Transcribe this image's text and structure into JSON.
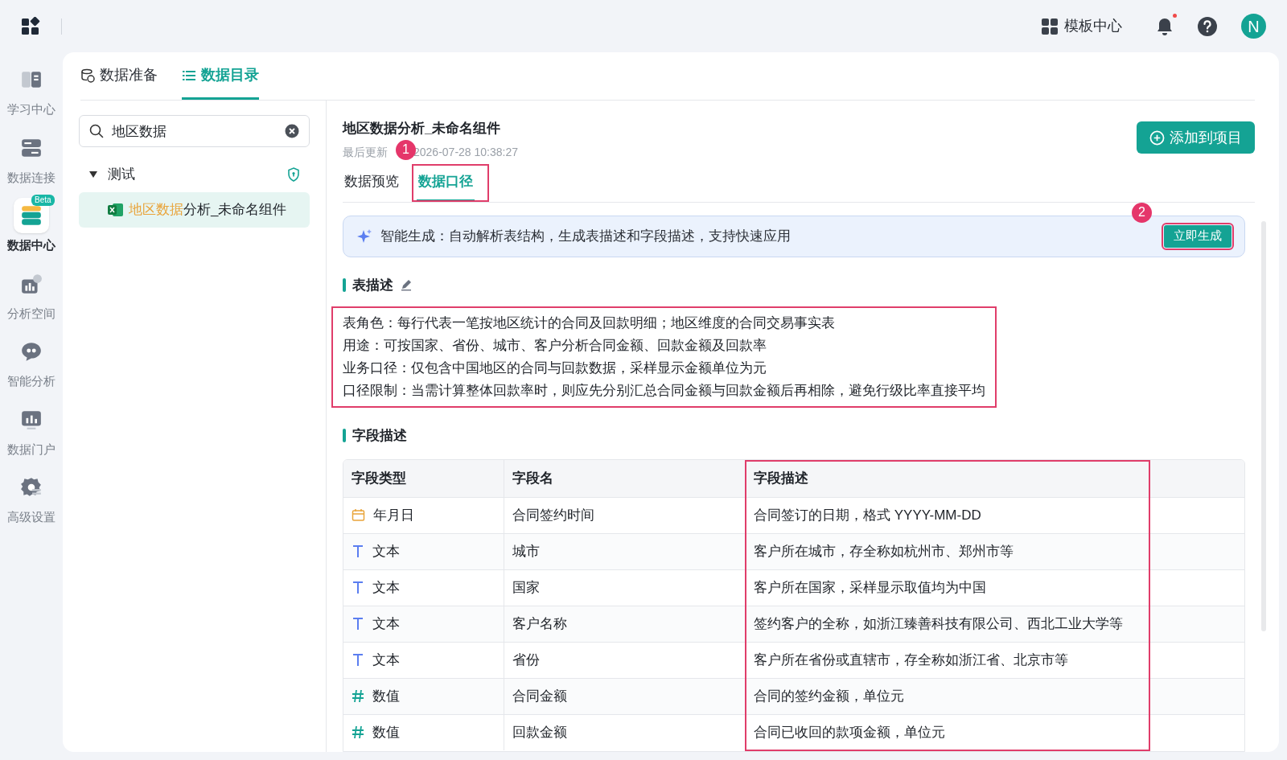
{
  "top_bar": {
    "template_center": "模板中心",
    "notification_dot": true,
    "avatar": "N"
  },
  "sidebar": {
    "items": [
      {
        "label": "学习中心",
        "selected": false
      },
      {
        "label": "数据连接",
        "selected": false
      },
      {
        "label": "数据中心",
        "selected": true,
        "badge": "Beta"
      },
      {
        "label": "分析空间",
        "selected": false
      },
      {
        "label": "智能分析",
        "selected": false
      },
      {
        "label": "数据门户",
        "selected": false
      },
      {
        "label": "高级设置",
        "selected": false
      }
    ]
  },
  "nav_tabs": [
    {
      "label": "数据准备",
      "selected": false
    },
    {
      "label": "数据目录",
      "selected": true
    }
  ],
  "search": {
    "value": "地区数据"
  },
  "tree": [
    {
      "label": "测试",
      "expanded": true,
      "children": [
        {
          "highlight": "地区数据",
          "label": "分析_未命名组件",
          "selected": true
        }
      ]
    }
  ],
  "detail": {
    "title": "地区数据分析_未命名组件",
    "updated": "最后更新",
    "updated_time": "2026-07-28 10:38:27",
    "add_button": "添加到项目",
    "tabs": [
      {
        "label": "数据预览",
        "selected": false
      },
      {
        "label": "数据口径",
        "selected": true,
        "marker": "1",
        "outlined": true
      }
    ],
    "banner": {
      "text": "智能生成：自动解析表结构，生成表描述和字段描述，支持快速应用",
      "button": "立即生成",
      "marker": "2",
      "outlined": true
    },
    "table_description": {
      "heading": "表描述",
      "outlined": true,
      "lines": [
        "表角色：每行代表一笔按地区统计的合同及回款明细；地区维度的合同交易事实表",
        "用途：可按国家、省份、城市、客户分析合同金额、回款金额及回款率",
        "业务口径：仅包含中国地区的合同与回款数据，采样显示金额单位为元",
        "口径限制：当需计算整体回款率时，则应先分别汇总合同金额与回款金额后再相除，避免行级比率直接平均"
      ]
    },
    "field_description": {
      "heading": "字段描述",
      "columns": [
        {
          "label": "字段类型",
          "outlined": false
        },
        {
          "label": "字段名",
          "outlined": false
        },
        {
          "label": "字段描述",
          "outlined": true
        }
      ],
      "rows": [
        {
          "kind": "date",
          "type": "年月日",
          "name": "合同签约时间",
          "description": "合同签订的日期，格式 YYYY-MM-DD"
        },
        {
          "kind": "text",
          "type": "文本",
          "name": "城市",
          "description": "客户所在城市，存全称如杭州市、郑州市等"
        },
        {
          "kind": "text",
          "type": "文本",
          "name": "国家",
          "description": "客户所在国家，采样显示取值均为中国"
        },
        {
          "kind": "text",
          "type": "文本",
          "name": "客户名称",
          "description": "签约客户的全称，如浙江臻善科技有限公司、西北工业大学等"
        },
        {
          "kind": "text",
          "type": "文本",
          "name": "省份",
          "description": "客户所在省份或直辖市，存全称如浙江省、北京市等"
        },
        {
          "kind": "number",
          "type": "数值",
          "name": "合同金额",
          "description": "合同的签约金额，单位元"
        },
        {
          "kind": "number",
          "type": "数值",
          "name": "回款金额",
          "description": "合同已收回的款项金额，单位元"
        }
      ]
    }
  }
}
